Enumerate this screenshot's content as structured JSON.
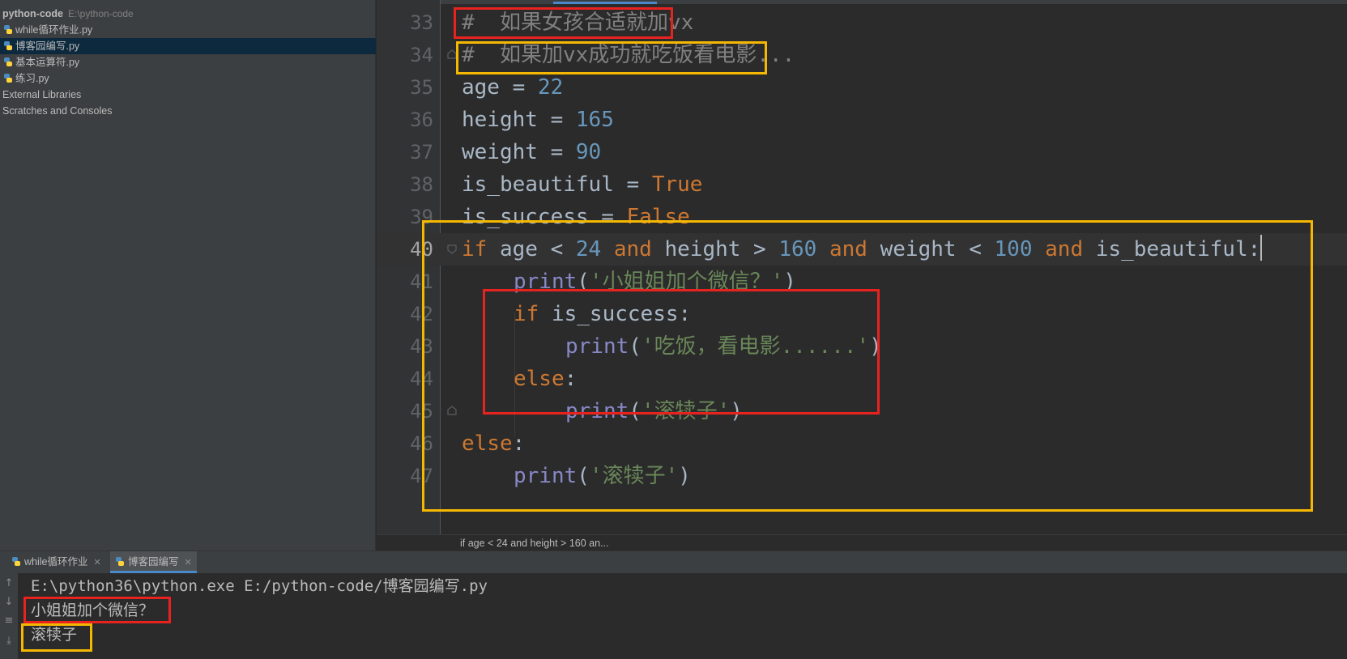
{
  "project": {
    "root_name": "python-code",
    "root_path": "E:\\python-code",
    "files": [
      {
        "name": "while循环作业.py",
        "selected": false
      },
      {
        "name": "博客园编写.py",
        "selected": true
      },
      {
        "name": "基本运算符.py",
        "selected": false
      },
      {
        "name": "练习.py",
        "selected": false
      }
    ],
    "external_libraries": "External Libraries",
    "scratches": "Scratches and Consoles"
  },
  "editor": {
    "line_numbers": [
      "33",
      "34",
      "35",
      "36",
      "37",
      "38",
      "39",
      "40",
      "41",
      "42",
      "43",
      "44",
      "45",
      "46",
      "47"
    ],
    "current_line": "40",
    "code": {
      "l33": "#  如果女孩合适就加vx",
      "l34": "#  如果加vx成功就吃饭看电影...",
      "l35_var": "age",
      "l35_op": " = ",
      "l35_val": "22",
      "l36_var": "height",
      "l36_op": " = ",
      "l36_val": "165",
      "l37_var": "weight",
      "l37_op": " = ",
      "l37_val": "90",
      "l38_var": "is_beautiful",
      "l38_op": " = ",
      "l38_val": "True",
      "l39_var": "is_success",
      "l39_op": " = ",
      "l39_val": "False",
      "l40_if": "if",
      "l40_a": " age < ",
      "l40_n1": "24",
      "l40_and1": " and",
      "l40_b": " height > ",
      "l40_n2": "160",
      "l40_and2": " and",
      "l40_c": " weight < ",
      "l40_n3": "100",
      "l40_and3": " and",
      "l40_d": " is_beautiful:",
      "l41_fn": "print",
      "l41_p1": "(",
      "l41_str": "'小姐姐加个微信？'",
      "l41_p2": ")",
      "l42_if": "if",
      "l42_rest": " is_success:",
      "l43_fn": "print",
      "l43_p1": "(",
      "l43_str": "'吃饭，看电影......'",
      "l43_p2": ")",
      "l44_else": "else",
      "l44_colon": ":",
      "l45_fn": "print",
      "l45_p1": "(",
      "l45_str": "'滚犊子'",
      "l45_p2": ")",
      "l46_else": "else",
      "l46_colon": ":",
      "l47_fn": "print",
      "l47_p1": "(",
      "l47_str": "'滚犊子'",
      "l47_p2": ")"
    },
    "breadcrumb": "if age < 24 and height > 160 an..."
  },
  "run": {
    "tabs": [
      {
        "label": "while循环作业",
        "active": false
      },
      {
        "label": "博客园编写",
        "active": true
      }
    ],
    "command": "E:\\python36\\python.exe E:/python-code/博客园编写.py",
    "output": [
      "小姐姐加个微信？",
      "滚犊子"
    ]
  },
  "colors": {
    "keyword": "#cc7832",
    "number": "#6897bb",
    "string": "#6a8759",
    "builtin": "#8888c6",
    "comment": "#808080",
    "annotation_red": "#e8231f",
    "annotation_yellow": "#f5b800"
  }
}
